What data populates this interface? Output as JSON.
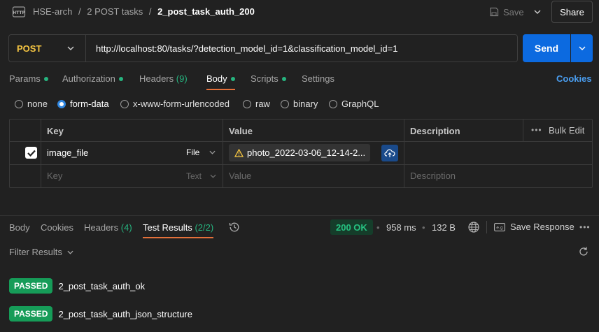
{
  "header": {
    "breadcrumb": [
      "HSE-arch",
      "2 POST tasks"
    ],
    "separator": "/",
    "request_name": "2_post_task_auth_200",
    "save_label": "Save",
    "share_label": "Share",
    "http_icon_text": "HTTP"
  },
  "request": {
    "method": "POST",
    "url": "http://localhost:80/tasks/?detection_model_id=1&classification_model_id=1",
    "send_label": "Send"
  },
  "tabs": [
    {
      "label": "Params",
      "dot": true
    },
    {
      "label": "Authorization",
      "dot": true
    },
    {
      "label": "Headers",
      "count": "(9)"
    },
    {
      "label": "Body",
      "dot": true,
      "active": true
    },
    {
      "label": "Scripts",
      "dot": true
    },
    {
      "label": "Settings"
    }
  ],
  "cookies_label": "Cookies",
  "body_types": [
    "none",
    "form-data",
    "x-www-form-urlencoded",
    "raw",
    "binary",
    "GraphQL"
  ],
  "body_type_selected": "form-data",
  "table": {
    "headers": {
      "key": "Key",
      "value": "Value",
      "description": "Description",
      "bulk_edit": "Bulk Edit"
    },
    "rows": [
      {
        "checked": true,
        "key": "image_file",
        "type": "File",
        "value": "photo_2022-03-06_12-14-2...",
        "description": ""
      }
    ],
    "placeholder": {
      "key": "Key",
      "type": "Text",
      "value": "Value",
      "description": "Description"
    }
  },
  "response": {
    "tabs": [
      "Body",
      "Cookies",
      "Headers",
      "Test Results"
    ],
    "headers_count": "(4)",
    "tests_count": "(2/2)",
    "active_tab": "Test Results",
    "status": "200 OK",
    "time": "958 ms",
    "size": "132 B",
    "save_response_label": "Save Response",
    "filter_label": "Filter Results",
    "tests": [
      {
        "status": "PASSED",
        "name": "2_post_task_auth_ok"
      },
      {
        "status": "PASSED",
        "name": "2_post_task_auth_json_structure"
      }
    ]
  },
  "colors": {
    "background": "#212121",
    "accent_blue": "#0c6ae0",
    "method_yellow": "#f5c542",
    "success_green": "#169c58",
    "tab_underline": "#e4703a"
  }
}
